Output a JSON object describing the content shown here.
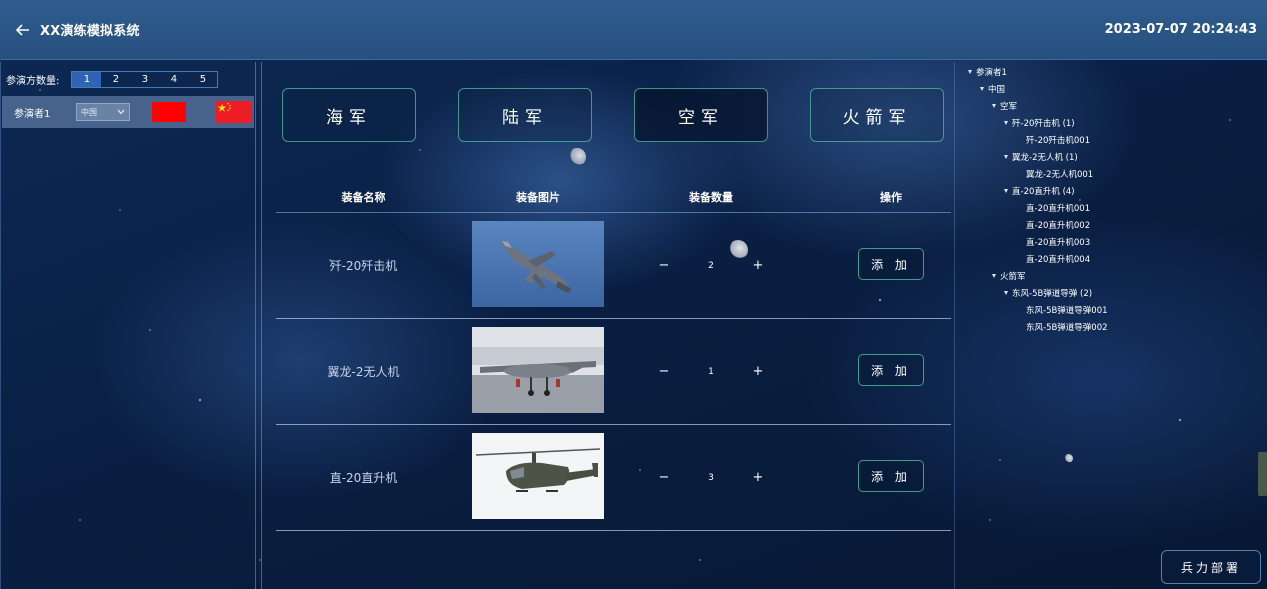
{
  "header": {
    "title": "XX演练模拟系统",
    "datetime": "2023-07-07 20:24:43"
  },
  "participants": {
    "count_label": "参演方数量:",
    "count_options": [
      "1",
      "2",
      "3",
      "4",
      "5"
    ],
    "selected_count": "1",
    "rows": [
      {
        "name": "参演者1",
        "country": "中国",
        "color": "#ff0000"
      }
    ]
  },
  "branches": {
    "tabs": [
      "海军",
      "陆军",
      "空军",
      "火箭军"
    ],
    "active": "空军"
  },
  "table": {
    "headers": [
      "装备名称",
      "装备图片",
      "装备数量",
      "操作"
    ],
    "rows": [
      {
        "name": "歼-20歼击机",
        "image": "j20-fighter-image",
        "qty": "2",
        "action": "添 加"
      },
      {
        "name": "翼龙-2无人机",
        "image": "wing-loong-2-drone-image",
        "qty": "1",
        "action": "添 加"
      },
      {
        "name": "直-20直升机",
        "image": "z20-helicopter-image",
        "qty": "3",
        "action": "添 加"
      }
    ],
    "minus": "−",
    "plus": "+"
  },
  "tree": [
    {
      "label": "参演者1",
      "level": 0,
      "caret": true
    },
    {
      "label": "中国",
      "level": 1,
      "caret": true
    },
    {
      "label": "空军",
      "level": 2,
      "caret": true
    },
    {
      "label": "歼-20歼击机 (1)",
      "level": 3,
      "caret": true
    },
    {
      "label": "歼-20歼击机001",
      "level": 4,
      "caret": false
    },
    {
      "label": "翼龙-2无人机 (1)",
      "level": 3,
      "caret": true
    },
    {
      "label": "翼龙-2无人机001",
      "level": 4,
      "caret": false
    },
    {
      "label": "直-20直升机 (4)",
      "level": 3,
      "caret": true
    },
    {
      "label": "直-20直升机001",
      "level": 4,
      "caret": false
    },
    {
      "label": "直-20直升机002",
      "level": 4,
      "caret": false
    },
    {
      "label": "直-20直升机003",
      "level": 4,
      "caret": false
    },
    {
      "label": "直-20直升机004",
      "level": 4,
      "caret": false
    },
    {
      "label": "火箭军",
      "level": 2,
      "caret": true
    },
    {
      "label": "东风-5B弹道导弹 (2)",
      "level": 3,
      "caret": true
    },
    {
      "label": "东风-5B弹道导弹001",
      "level": 4,
      "caret": false
    },
    {
      "label": "东风-5B弹道导弹002",
      "level": 4,
      "caret": false
    }
  ],
  "deploy_label": "兵力部署",
  "colors": {
    "accent_green": "#50bea0",
    "tab_active": "#2f64b4",
    "header_bg": "#2f5d8f"
  }
}
